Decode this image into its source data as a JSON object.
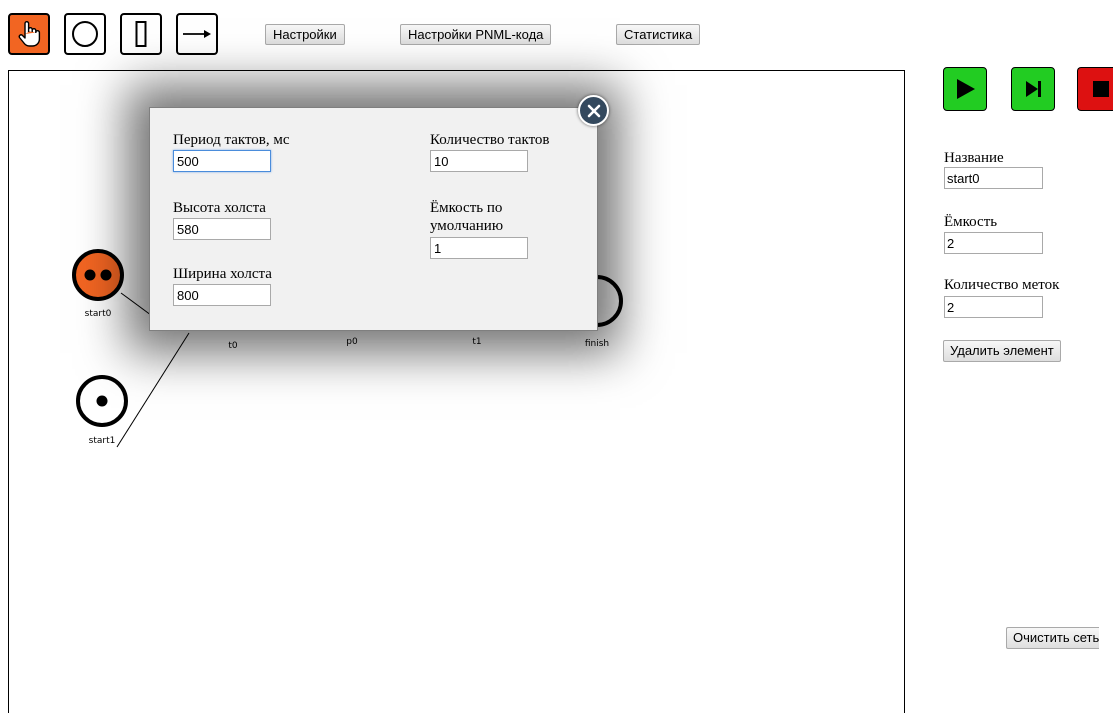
{
  "toolbar": {
    "tools": [
      {
        "name": "pointer-tool",
        "icon": "hand-pointer-icon",
        "active": true
      },
      {
        "name": "place-tool",
        "icon": "circle-icon",
        "active": false
      },
      {
        "name": "transition-tool",
        "icon": "rectangle-icon",
        "active": false
      },
      {
        "name": "arc-tool",
        "icon": "arrow-right-icon",
        "active": false
      }
    ],
    "settings_label": "Настройки",
    "pnml_settings_label": "Настройки PNML-кода",
    "statistics_label": "Статистика"
  },
  "net": {
    "places": [
      {
        "name": "start0",
        "tokens": 2,
        "selected": true
      },
      {
        "name": "start1",
        "tokens": 1,
        "selected": false
      },
      {
        "name": "finish",
        "tokens": 0,
        "selected": false
      }
    ],
    "labels": [
      "t0",
      "p0",
      "t1"
    ]
  },
  "settings_modal": {
    "period_label": "Период тактов, мс",
    "period_value": "500",
    "height_label": "Высота холста",
    "height_value": "580",
    "width_label": "Ширина холста",
    "width_value": "800",
    "ticks_label": "Количество тактов",
    "ticks_value": "10",
    "default_capacity_label_line1": "Ёмкость по",
    "default_capacity_label_line2": "умолчанию",
    "default_capacity_value": "1"
  },
  "properties": {
    "name_label": "Название",
    "name_value": "start0",
    "capacity_label": "Ёмкость",
    "capacity_value": "2",
    "tokens_label": "Количество меток",
    "tokens_value": "2",
    "delete_label": "Удалить элемент",
    "clear_label": "Очистить сеть"
  },
  "colors": {
    "accent_orange": "#f26522",
    "play_green": "#22cc22",
    "stop_red": "#dd1111",
    "close_button": "#34495e"
  }
}
